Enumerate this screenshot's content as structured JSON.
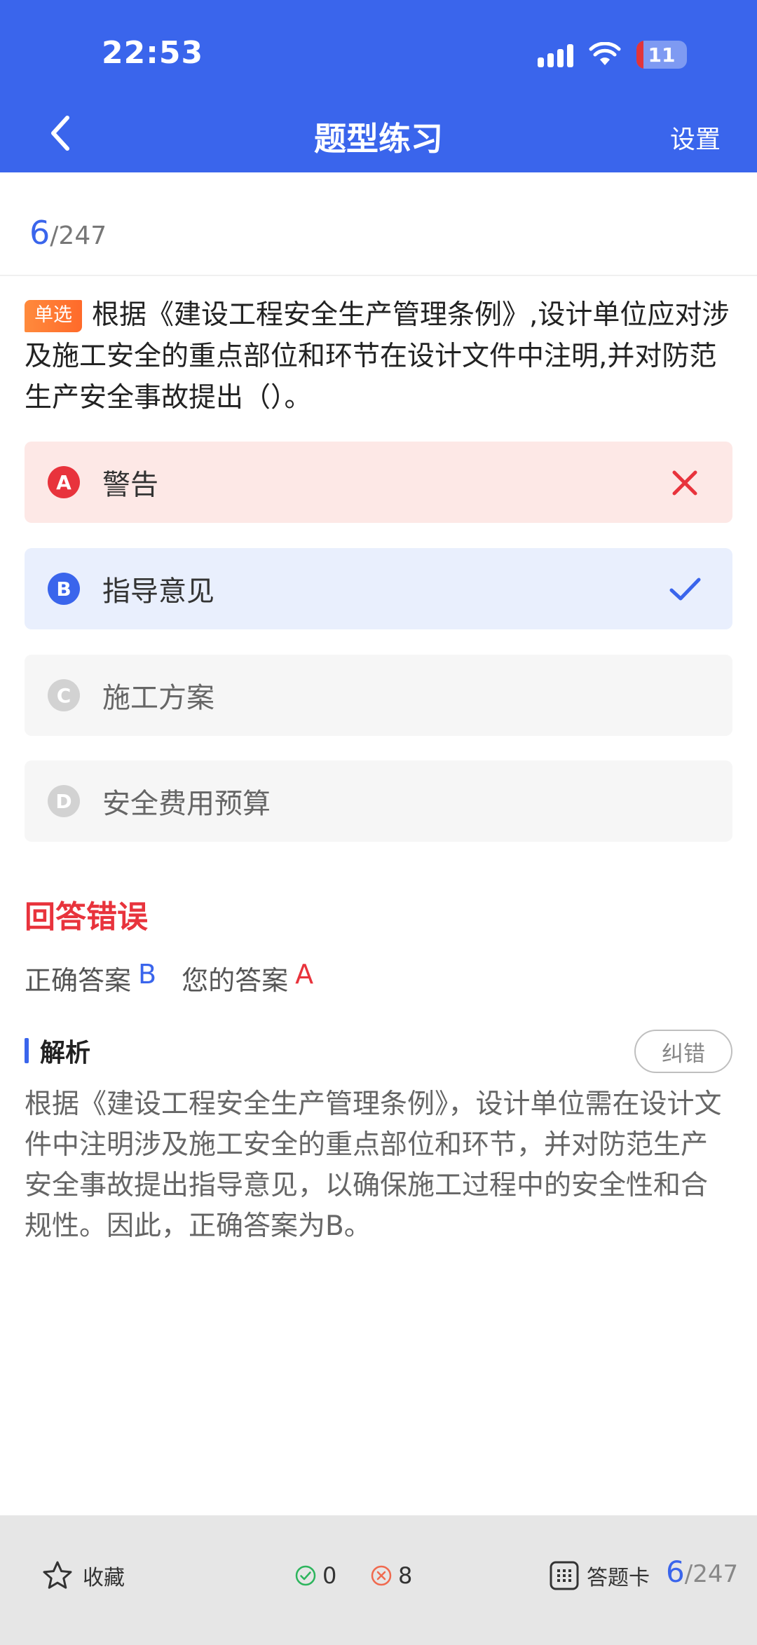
{
  "status_bar": {
    "time": "22:53",
    "battery": "11"
  },
  "header": {
    "title": "题型练习",
    "settings": "设置"
  },
  "progress": {
    "current": "6",
    "total": "/247"
  },
  "question": {
    "type_tag": "单选",
    "text": "根据《建设工程安全生产管理条例》,设计单位应对涉及施工安全的重点部位和环节在设计文件中注明,并对防范生产安全事故提出（）。"
  },
  "options": [
    {
      "letter": "A",
      "text": "警告",
      "state": "wrong"
    },
    {
      "letter": "B",
      "text": "指导意见",
      "state": "correct"
    },
    {
      "letter": "C",
      "text": "施工方案",
      "state": "normal"
    },
    {
      "letter": "D",
      "text": "安全费用预算",
      "state": "normal"
    }
  ],
  "result": {
    "title": "回答错误",
    "correct_label": "正确答案",
    "correct_value": "B",
    "yours_label": "您的答案",
    "yours_value": "A"
  },
  "analysis": {
    "title": "解析",
    "report_button": "纠错",
    "text": "根据《建设工程安全生产管理条例》，设计单位需在设计文件中注明涉及施工安全的重点部位和环节，并对防范生产安全事故提出指导意见，以确保施工过程中的安全性和合规性。因此，正确答案为B。"
  },
  "bottom_bar": {
    "favorite": "收藏",
    "correct_count": "0",
    "wrong_count": "8",
    "answer_card": "答题卡",
    "progress_current": "6",
    "progress_total": "/247"
  },
  "colors": {
    "primary": "#3a65ec",
    "error": "#e8333c",
    "tag_orange": "#ff7a33",
    "success_green": "#2db55d"
  },
  "icons": {
    "back": "chevron-left-icon",
    "wrong_mark": "cross-icon",
    "right_mark": "check-icon",
    "favorite": "star-outline-icon",
    "correct_stat": "check-circle-icon",
    "wrong_stat": "cross-circle-icon",
    "answer_card": "grid-icon"
  }
}
